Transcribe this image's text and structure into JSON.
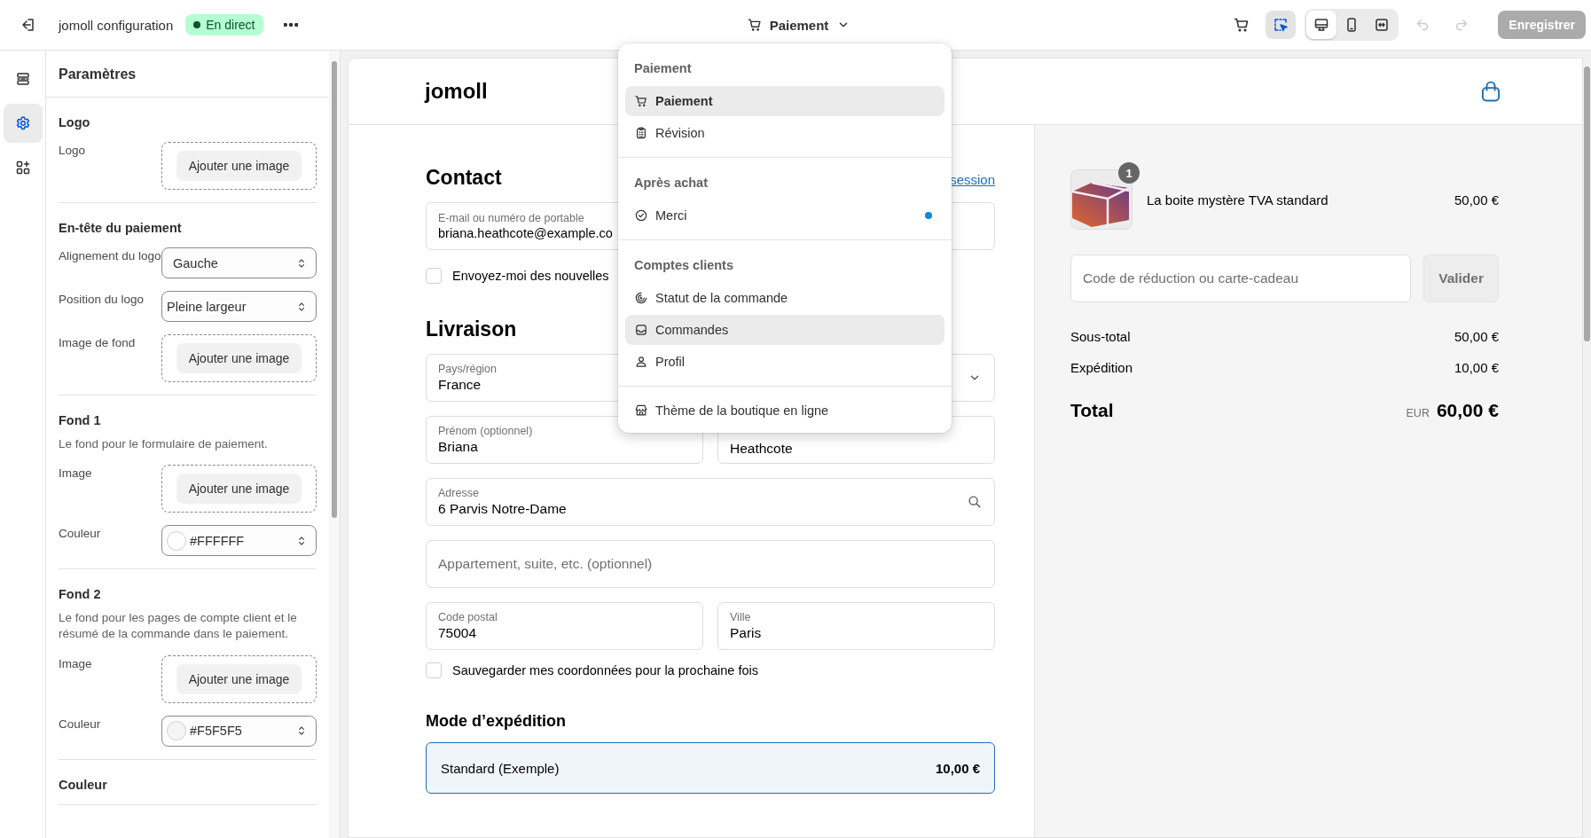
{
  "topbar": {
    "title": "jomoll configuration",
    "status": "En direct",
    "page": "Paiement",
    "inspect_active": true,
    "views": [
      {
        "selected": true
      },
      {
        "selected": false
      },
      {
        "selected": false
      }
    ],
    "undo_disabled": true,
    "redo_disabled": true,
    "save": {
      "label": "Enregistrer",
      "disabled": true
    }
  },
  "rail": {
    "items": [
      {
        "selected": false
      },
      {
        "selected": true
      },
      {
        "selected": false
      }
    ]
  },
  "settings": {
    "title": "Paramètres",
    "sections": [
      {
        "title": "Logo",
        "rows": [
          {
            "kind": "image",
            "label": "Logo",
            "button": "Ajouter une image"
          }
        ]
      },
      {
        "title": "En-tête du paiement",
        "rows": [
          {
            "kind": "select",
            "label": "Alignement du logo",
            "value": "Gauche"
          },
          {
            "kind": "select",
            "label": "Position du logo",
            "value": "Pleine largeur"
          },
          {
            "kind": "image",
            "label": "Image de fond",
            "button": "Ajouter une image"
          }
        ]
      },
      {
        "title": "Fond 1",
        "description": "Le fond pour le formulaire de paiement.",
        "rows": [
          {
            "kind": "image",
            "label": "Image",
            "button": "Ajouter une image"
          },
          {
            "kind": "color",
            "label": "Couleur",
            "value": "#FFFFFF"
          }
        ]
      },
      {
        "title": "Fond 2",
        "description": "Le fond pour les pages de compte client et le résumé de la commande dans le paiement.",
        "rows": [
          {
            "kind": "image",
            "label": "Image",
            "button": "Ajouter une image"
          },
          {
            "kind": "color",
            "label": "Couleur",
            "value": "#F5F5F5"
          }
        ]
      },
      {
        "title": "Couleur"
      }
    ]
  },
  "preview": {
    "store_name": "jomoll",
    "contact": {
      "heading": "Contact",
      "link": "session",
      "field": {
        "label": "E-mail ou numéro de portable",
        "value": "briana.heathcote@example.co"
      },
      "newsletter": {
        "label": "Envoyez-moi des nouvelles",
        "checked": false
      }
    },
    "delivery": {
      "heading": "Livraison",
      "rows": [
        [
          {
            "kind": "select",
            "label": "Pays/région",
            "value": "France"
          }
        ],
        [
          {
            "kind": "text",
            "label": "Prénom (optionnel)",
            "value": "Briana"
          },
          {
            "kind": "text",
            "value": "Heathcote"
          }
        ],
        [
          {
            "kind": "search",
            "label": "Adresse",
            "value": "6 Parvis Notre-Dame"
          }
        ],
        [
          {
            "kind": "empty",
            "placeholder": "Appartement, suite, etc. (optionnel)"
          }
        ],
        [
          {
            "kind": "text",
            "label": "Code postal",
            "value": "75004"
          },
          {
            "kind": "text",
            "label": "Ville",
            "value": "Paris"
          }
        ]
      ],
      "save": {
        "label": "Sauvegarder mes coordonnées pour la prochaine fois",
        "checked": false
      }
    },
    "shipping": {
      "heading": "Mode d’expédition",
      "options": [
        {
          "label": "Standard (Exemple)",
          "price": "10,00 €",
          "selected": true
        }
      ]
    }
  },
  "summary": {
    "items": [
      {
        "name": "La boite mystère TVA standard",
        "quantity": "1",
        "price": "50,00 €"
      }
    ],
    "discount": {
      "placeholder": "Code de réduction ou carte-cadeau",
      "button": "Valider"
    },
    "lines": [
      {
        "label": "Sous-total",
        "value": "50,00 €"
      },
      {
        "label": "Expédition",
        "value": "10,00 €"
      }
    ],
    "total": {
      "label": "Total",
      "currency": "EUR",
      "value": "60,00 €"
    }
  },
  "menu": {
    "groups": [
      {
        "title": "Paiement",
        "items": [
          {
            "label": "Paiement",
            "selected": true,
            "hovered": false,
            "unread": false
          },
          {
            "label": "Révision",
            "selected": false,
            "hovered": false,
            "unread": false
          }
        ]
      },
      {
        "title": "Après achat",
        "items": [
          {
            "label": "Merci",
            "selected": false,
            "hovered": false,
            "unread": true
          }
        ]
      },
      {
        "title": "Comptes clients",
        "items": [
          {
            "label": "Statut de la commande",
            "selected": false,
            "hovered": false,
            "unread": false
          },
          {
            "label": "Commandes",
            "selected": false,
            "hovered": true,
            "unread": false
          },
          {
            "label": "Profil",
            "selected": false,
            "hovered": false,
            "unread": false
          }
        ]
      },
      {
        "items": [
          {
            "label": "Thème de la boutique en ligne",
            "selected": false,
            "hovered": false,
            "unread": false
          }
        ]
      }
    ]
  }
}
